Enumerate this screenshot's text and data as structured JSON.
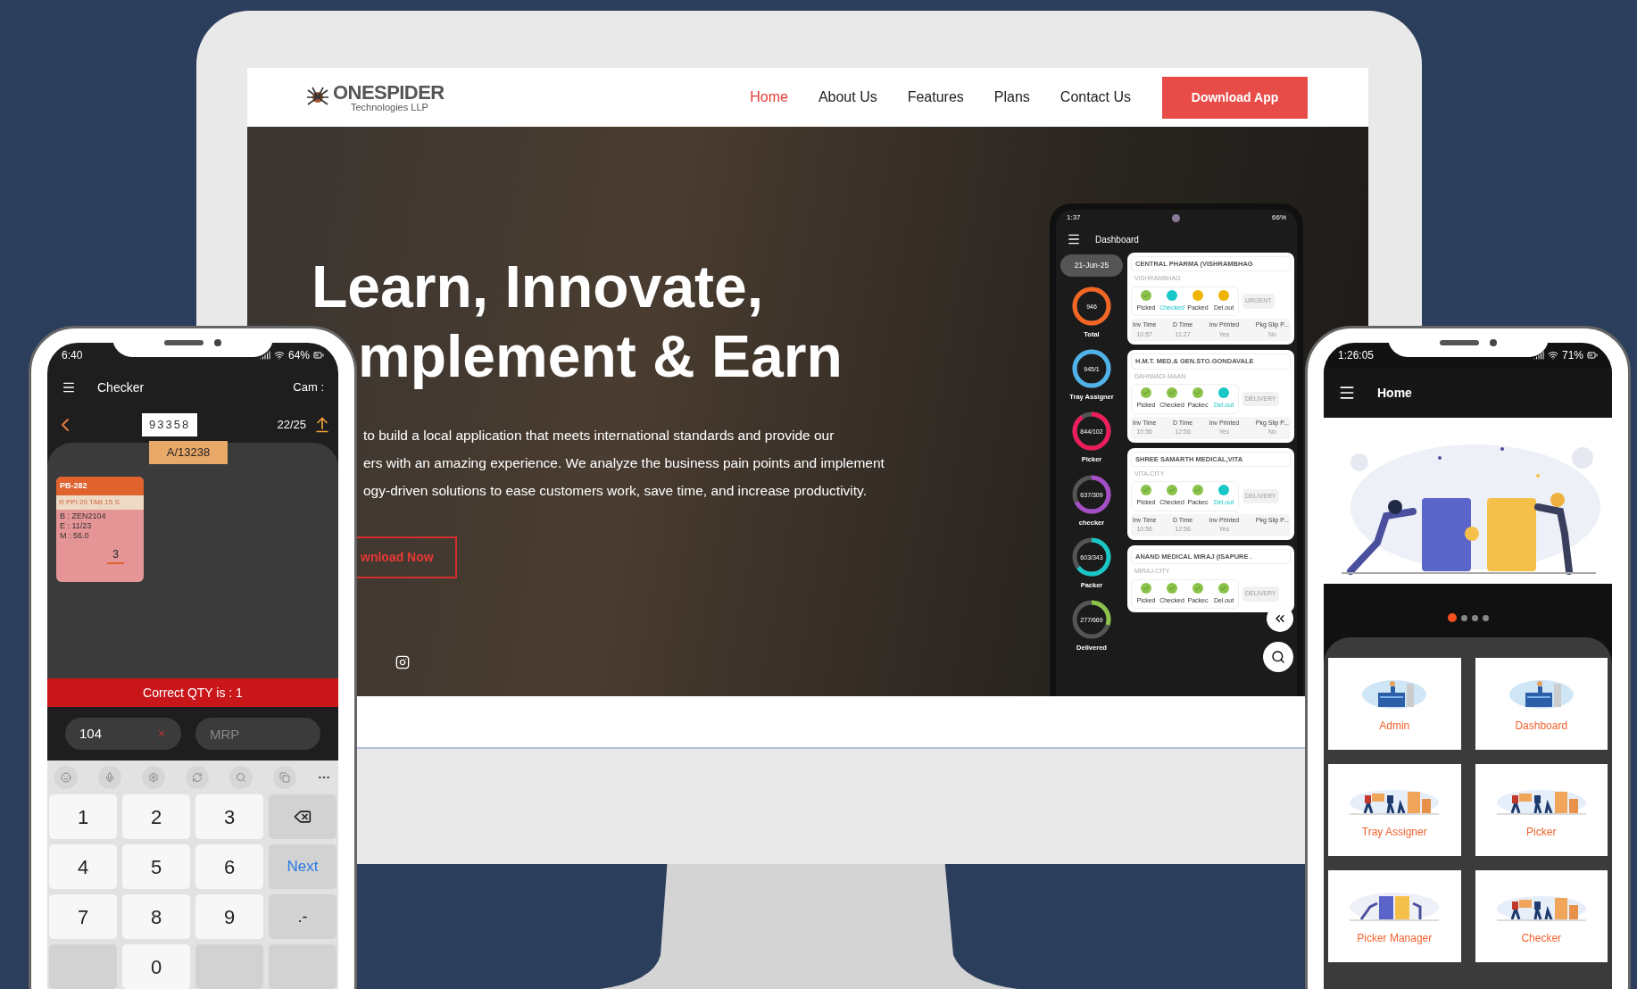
{
  "website": {
    "logo": {
      "name": "ONESPIDER",
      "tagline": "Technologies LLP"
    },
    "nav": [
      {
        "label": "Home",
        "selected": true
      },
      {
        "label": "About Us",
        "selected": false
      },
      {
        "label": "Features",
        "selected": false
      },
      {
        "label": "Plans",
        "selected": false
      },
      {
        "label": "Contact Us",
        "selected": false
      }
    ],
    "download_button": "Download App",
    "hero": {
      "headline_line_1": "Learn, Innovate,",
      "headline_line_2": "mplement & Earn",
      "paragraph": [
        "to build a local application that meets international standards and provide our",
        "ers with an amazing experience. We analyze the business pain points and implement",
        "ogy-driven solutions to ease customers work, save time, and increase productivity."
      ],
      "cta": "wnload Now"
    }
  },
  "dashboard_phone": {
    "status_time": "1:37",
    "battery": "66%",
    "title": "Dashboard",
    "date": "21-Jun-25",
    "stats": [
      {
        "value": "946",
        "label": "Total",
        "color": "#f26522",
        "level": 1
      },
      {
        "value": "945/1",
        "label": "Tray Assigner",
        "color": "#4fb3ea",
        "level": 1
      },
      {
        "value": "844/102",
        "label": "Picker",
        "color": "#ee1c5a",
        "level": 0.9
      },
      {
        "value": "637/309",
        "label": "checker",
        "color": "#a64dc8",
        "level": 0.67
      },
      {
        "value": "603/343",
        "label": "Packer",
        "color": "#19c7c7",
        "level": 0.64
      },
      {
        "value": "277/669",
        "label": "Delivered",
        "color": "#8bc34a",
        "level": 0.3
      }
    ],
    "orders": [
      {
        "name": "CENTRAL PHARMA (VISHRAMBHAG",
        "area": "VISHRAMBHAG",
        "tag": "URGENT",
        "steps": [
          {
            "label": "Picked",
            "done": true,
            "active": false
          },
          {
            "label": "Checked",
            "done": false,
            "active": true
          },
          {
            "label": "Packed",
            "done": false,
            "active": false
          },
          {
            "label": "Del.out",
            "done": false,
            "active": false
          }
        ],
        "times": [
          {
            "label": "Inv Time",
            "value": "10:57"
          },
          {
            "label": "D Time",
            "value": "11:27"
          },
          {
            "label": "Inv Printed",
            "value": "Yes"
          },
          {
            "label": "Pkg Slip P...",
            "value": "No"
          }
        ]
      },
      {
        "name": "H.M.T. MED.& GEN.STO.GONDAVALE",
        "area": "DAHIWADI-MAAN",
        "tag": "DELIVERY",
        "steps": [
          {
            "label": "Picked",
            "done": true,
            "active": false
          },
          {
            "label": "Checked",
            "done": true,
            "active": false
          },
          {
            "label": "Packec",
            "done": true,
            "active": false
          },
          {
            "label": "Del.out",
            "done": false,
            "active": true
          }
        ],
        "times": [
          {
            "label": "Inv Time",
            "value": "10:56"
          },
          {
            "label": "D Time",
            "value": "12:56"
          },
          {
            "label": "Inv Printed",
            "value": "Yes"
          },
          {
            "label": "Pkg Slip P...",
            "value": "No"
          }
        ]
      },
      {
        "name": "SHREE SAMARTH MEDICAL,VITA",
        "area": "VITA-CITY",
        "tag": "DELIVERY",
        "steps": [
          {
            "label": "Picked",
            "done": true,
            "active": false
          },
          {
            "label": "Checked",
            "done": true,
            "active": false
          },
          {
            "label": "Packec",
            "done": true,
            "active": false
          },
          {
            "label": "Del.out",
            "done": false,
            "active": true
          }
        ],
        "times": [
          {
            "label": "Inv Time",
            "value": "10:56"
          },
          {
            "label": "D Time",
            "value": "12:56"
          },
          {
            "label": "Inv Printed",
            "value": "Yes"
          },
          {
            "label": "Pkg Slip P..."
          }
        ]
      },
      {
        "name": "ANAND MEDICAL MIRAJ (ISAPURE .",
        "area": "MIRAJ-CITY",
        "tag": "DELIVERY",
        "steps": [
          {
            "label": "Picked",
            "done": true,
            "active": false
          },
          {
            "label": "Checked",
            "done": true,
            "active": false
          },
          {
            "label": "Packec",
            "done": true,
            "active": false
          },
          {
            "label": "Del.out",
            "done": true,
            "active": false
          }
        ]
      }
    ]
  },
  "checker_phone": {
    "status_time": "6:40",
    "battery": "64%",
    "title": "Checker",
    "camera": "Cam :",
    "barcode": "93358",
    "invoice": "A/13238",
    "count": "22/25",
    "item": {
      "code": "PB-282",
      "name": "R PPI 20 TAB 15 S",
      "batch": "B : ZEN2104",
      "expiry": "E : 11/23",
      "mrp": "M : 56.0",
      "quantity": "3"
    },
    "banner": "Correct QTY is : 1",
    "qty_field": {
      "value": "104"
    },
    "mrp_field": {
      "placeholder": "MRP"
    },
    "keys": [
      {
        "kind": "digit",
        "label": "1"
      },
      {
        "kind": "digit",
        "label": "2"
      },
      {
        "kind": "digit",
        "label": "3"
      },
      {
        "kind": "backspace"
      },
      {
        "kind": "digit",
        "label": "4"
      },
      {
        "kind": "digit",
        "label": "5"
      },
      {
        "kind": "digit",
        "label": "6"
      },
      {
        "kind": "action",
        "label": "Next"
      },
      {
        "kind": "digit",
        "label": "7"
      },
      {
        "kind": "digit",
        "label": "8"
      },
      {
        "kind": "digit",
        "label": "9"
      },
      {
        "kind": "symbol",
        "label": ".-"
      },
      {
        "kind": "blank"
      },
      {
        "kind": "digit",
        "label": "0"
      },
      {
        "kind": "blank"
      },
      {
        "kind": "blank"
      }
    ]
  },
  "home_phone": {
    "status_time": "1:26:05",
    "battery": "71%",
    "title": "Home",
    "dots": [
      {
        "selected": true
      },
      {
        "selected": false
      },
      {
        "selected": false
      },
      {
        "selected": false
      }
    ],
    "tiles": [
      "Admin",
      "Dashboard",
      "Tray Assigner",
      "Picker",
      "Picker Manager",
      "Checker"
    ]
  }
}
